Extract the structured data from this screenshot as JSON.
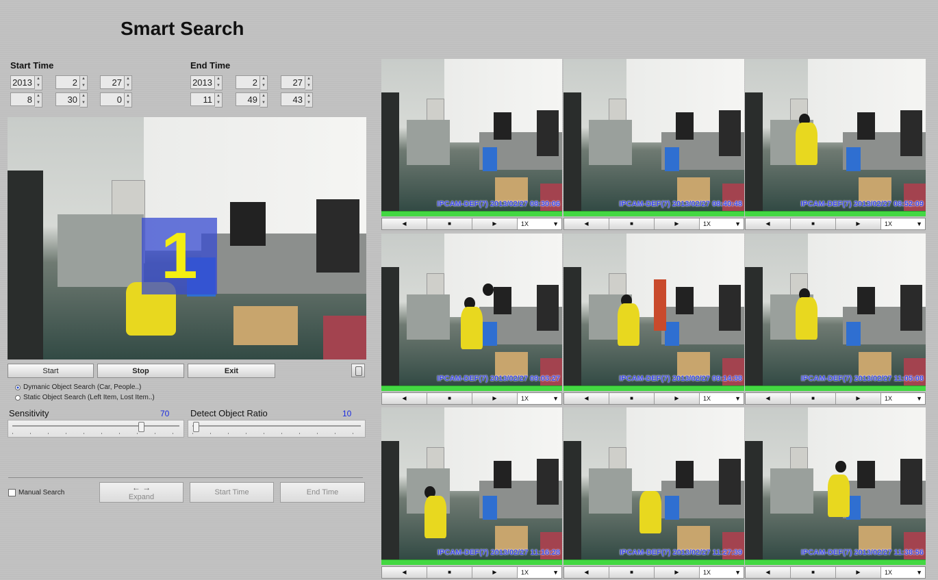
{
  "app": {
    "title": "Smart Search"
  },
  "start_time": {
    "label": "Start Time",
    "year": "2013",
    "month": "2",
    "day": "27",
    "hour": "8",
    "minute": "30",
    "second": "0"
  },
  "end_time": {
    "label": "End Time",
    "year": "2013",
    "month": "2",
    "day": "27",
    "hour": "11",
    "minute": "49",
    "second": "43"
  },
  "main_view": {
    "overlay_number": "1"
  },
  "controls": {
    "start_label": "Start",
    "stop_label": "Stop",
    "exit_label": "Exit"
  },
  "search_mode": {
    "options": [
      {
        "label": "Dymanic Object Search (Car, People..)",
        "selected": true
      },
      {
        "label": "Static Object Search (Left Item, Lost Item..)",
        "selected": false
      }
    ]
  },
  "sensitivity": {
    "label": "Sensitivity",
    "value": "70",
    "level": 0.7
  },
  "detect_ratio": {
    "label": "Detect Object Ratio",
    "value": "10",
    "level": 0.0
  },
  "manual": {
    "checkbox_label": "Manual Search",
    "expand_icon": "← →",
    "expand_label": "Expand",
    "start_time_label": "Start Time",
    "end_time_label": "End Time"
  },
  "cameras": [
    {
      "stamp": "IPCAM-DEF(7) 2013/02/27 08:30:06",
      "speed": "1X"
    },
    {
      "stamp": "IPCAM-DEF(7) 2013/02/27 08:40:48",
      "speed": "1X"
    },
    {
      "stamp": "IPCAM-DEF(7) 2013/02/27 08:52:09",
      "speed": "1X"
    },
    {
      "stamp": "IPCAM-DEF(7) 2013/02/27 09:03:27",
      "speed": "1X"
    },
    {
      "stamp": "IPCAM-DEF(7) 2013/02/27 09:14:38",
      "speed": "1X"
    },
    {
      "stamp": "IPCAM-DEF(7) 2013/02/27 11:05:08",
      "speed": "1X"
    },
    {
      "stamp": "IPCAM-DEF(7) 2013/02/27 11:16:28",
      "speed": "1X"
    },
    {
      "stamp": "IPCAM-DEF(7) 2013/02/27 11:27:39",
      "speed": "1X"
    },
    {
      "stamp": "IPCAM-DEF(7) 2013/02/27 11:38:56",
      "speed": "1X"
    }
  ],
  "playback_icons": [
    "rewind-icon",
    "stop-icon",
    "play-icon"
  ],
  "colors": {
    "accent_blue": "#1a2be0",
    "progress_green": "#43d842",
    "overlay_blue": "#374bd2",
    "overlay_yellow": "#f4ee12"
  }
}
